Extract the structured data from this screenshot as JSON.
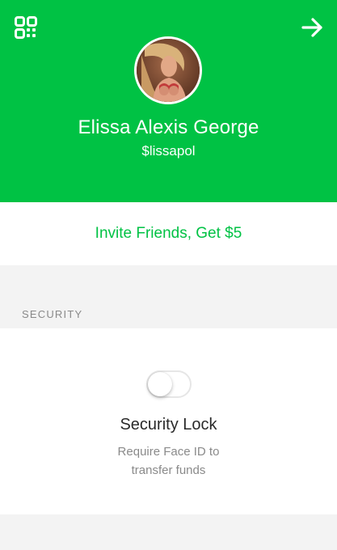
{
  "colors": {
    "brand_green": "#00c244",
    "background_gray": "#f3f3f3"
  },
  "header": {
    "left_icon": "qr-code-icon",
    "right_icon": "arrow-right-icon"
  },
  "profile": {
    "name": "Elissa Alexis George",
    "handle": "$lissapol"
  },
  "invite": {
    "label": "Invite Friends, Get $5"
  },
  "security": {
    "section_label": "SECURITY",
    "toggle_on": false,
    "title": "Security Lock",
    "description_line1": "Require Face ID to",
    "description_line2": "transfer funds"
  }
}
